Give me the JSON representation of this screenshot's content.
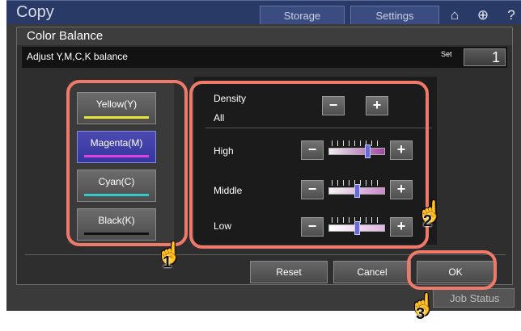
{
  "app": {
    "title": "Copy",
    "tabs": [
      "Storage",
      "Settings"
    ],
    "icons": [
      "home-icon",
      "globe-icon",
      "help-icon"
    ],
    "job_status": "Job Status"
  },
  "dialog": {
    "title": "Color Balance",
    "subtitle": "Adjust Y,M,C,K balance",
    "set_label": "Set",
    "set_value": "1"
  },
  "colors": [
    {
      "label": "Yellow(Y)",
      "swatch": "#e6e63a",
      "selected": false
    },
    {
      "label": "Magenta(M)",
      "swatch": "#e040e0",
      "selected": true
    },
    {
      "label": "Cyan(C)",
      "swatch": "#36c8c8",
      "selected": false
    },
    {
      "label": "Black(K)",
      "swatch": "#111111",
      "selected": false
    }
  ],
  "density": {
    "label": "Density",
    "scope": "All",
    "minus": "−",
    "plus": "+"
  },
  "levels": [
    {
      "label": "High",
      "value_fraction": 0.72
    },
    {
      "label": "Middle",
      "value_fraction": 0.5
    },
    {
      "label": "Low",
      "value_fraction": 0.5
    }
  ],
  "footer": {
    "reset": "Reset",
    "cancel": "Cancel",
    "ok": "OK"
  },
  "annotations": {
    "callouts": [
      "1",
      "2",
      "3"
    ],
    "highlight_color": "#f07a6a"
  }
}
